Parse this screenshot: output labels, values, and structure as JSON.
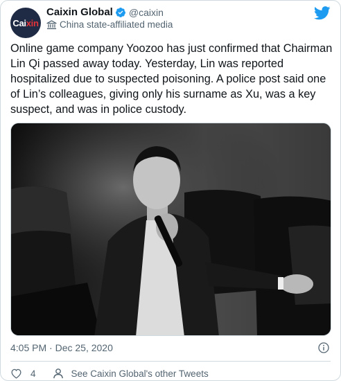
{
  "header": {
    "avatar_text_a": "Cai",
    "avatar_text_b": "xin",
    "display_name": "Caixin Global",
    "handle": "@caixin",
    "state_label": "China state-affiliated media"
  },
  "tweet": {
    "text": "Online game company Yoozoo has just confirmed that Chairman Lin Qi passed away today. Yesterday, Lin was reported hospitalized due to suspected poisoning. A police post said one of Lin’s colleagues, giving only his surname as Xu, was a key suspect, and was in police custody."
  },
  "footer": {
    "timestamp": "4:05 PM · Dec 25, 2020",
    "like_count": "4",
    "other_tweets_label": "See Caixin Global's other Tweets"
  },
  "colors": {
    "twitter_blue": "#1d9bf0",
    "secondary_text": "#536471",
    "divider": "#cfd9de"
  },
  "icons": [
    "verified-badge-icon",
    "state-media-flag-icon",
    "twitter-bird-icon",
    "info-icon",
    "heart-icon",
    "person-icon"
  ]
}
